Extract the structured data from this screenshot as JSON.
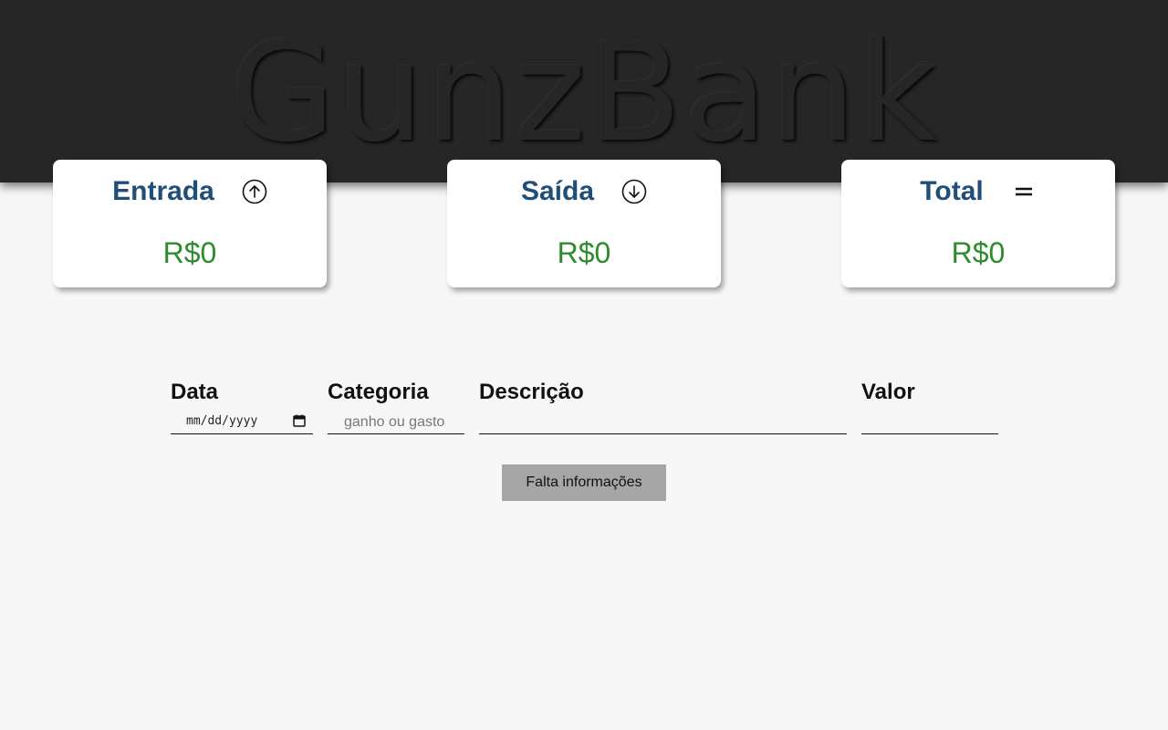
{
  "header": {
    "brand": "GunzBank"
  },
  "cards": {
    "entrada": {
      "title": "Entrada",
      "icon": "arrow-up-circle-icon",
      "value": "R$0"
    },
    "saida": {
      "title": "Saída",
      "icon": "arrow-down-circle-icon",
      "value": "R$0"
    },
    "total": {
      "title": "Total",
      "icon": "equals-icon",
      "value": "R$0"
    }
  },
  "form": {
    "data": {
      "label": "Data",
      "value": "mm/dd/yyyy"
    },
    "categoria": {
      "label": "Categoria",
      "placeholder": "ganho ou gasto"
    },
    "descricao": {
      "label": "Descrição",
      "value": ""
    },
    "valor": {
      "label": "Valor",
      "value": ""
    },
    "submit_label": "Falta informações"
  },
  "colors": {
    "header_bg": "#262626",
    "page_bg": "#f7f7f7",
    "card_title": "#1f4e79",
    "card_value": "#2e8b2e",
    "button_bg": "#a6a6a6"
  }
}
